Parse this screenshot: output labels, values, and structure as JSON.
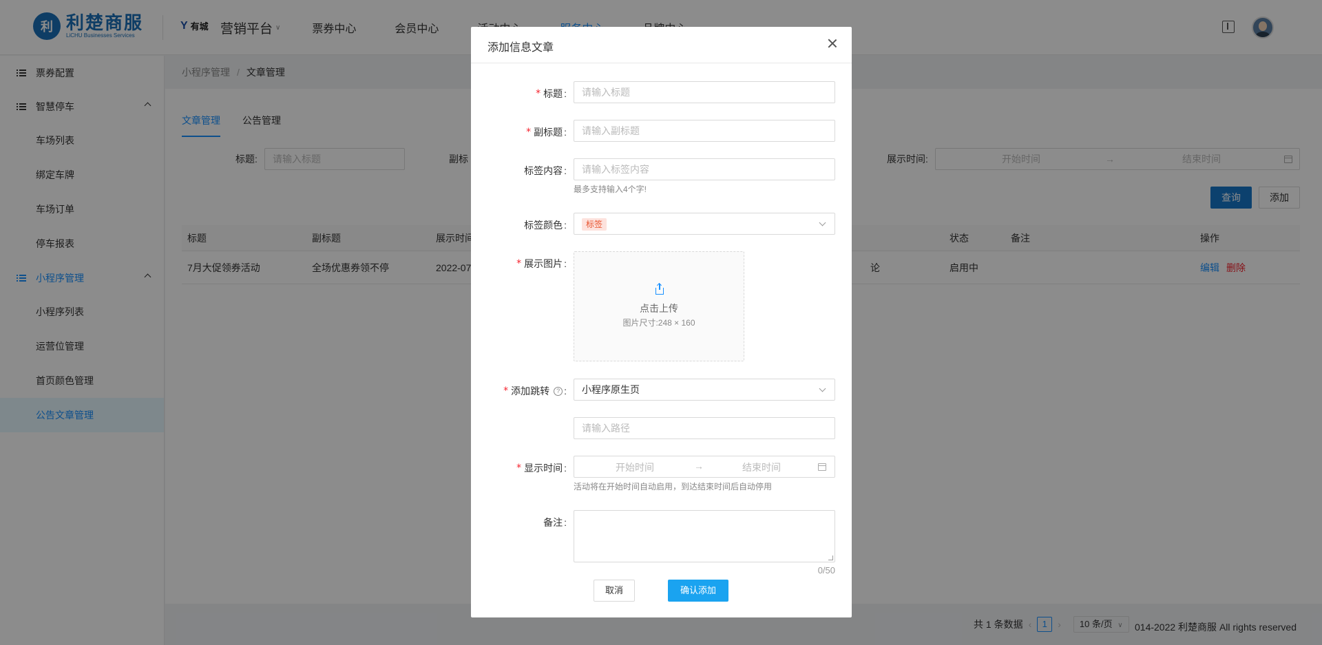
{
  "header": {
    "logo_main": "利楚商服",
    "logo_sub": "LiCHU Businesses Services",
    "brand": "有城",
    "nav": [
      {
        "label": "营销平台"
      },
      {
        "label": "票券中心"
      },
      {
        "label": "会员中心"
      },
      {
        "label": "活动中心"
      },
      {
        "label": "服务中心"
      },
      {
        "label": "品牌中心"
      }
    ]
  },
  "sidebar": {
    "items": [
      {
        "label": "票券配置"
      },
      {
        "label": "智慧停车"
      },
      {
        "label": "车场列表"
      },
      {
        "label": "绑定车牌"
      },
      {
        "label": "车场订单"
      },
      {
        "label": "停车报表"
      },
      {
        "label": "小程序管理"
      },
      {
        "label": "小程序列表"
      },
      {
        "label": "运营位管理"
      },
      {
        "label": "首页颜色管理"
      },
      {
        "label": "公告文章管理"
      }
    ]
  },
  "breadcrumb": {
    "parent": "小程序管理",
    "sep": "/",
    "current": "文章管理"
  },
  "tabs": [
    {
      "label": "文章管理"
    },
    {
      "label": "公告管理"
    }
  ],
  "filters": {
    "title_label": "标题:",
    "title_placeholder": "请输入标题",
    "subtitle_label": "副标",
    "time_label": "展示时间:",
    "start_placeholder": "开始时间",
    "end_placeholder": "结束时间",
    "query": "查询",
    "add": "添加"
  },
  "table": {
    "headers": {
      "title": "标题",
      "subtitle": "副标题",
      "time": "展示时间",
      "status": "状态",
      "remark": "备注",
      "ops": "操作"
    },
    "rows": [
      {
        "title": "7月大促领券活动",
        "subtitle": "全场优惠券领不停",
        "time": "2022-07",
        "tag": "论",
        "status": "启用中",
        "edit": "编辑",
        "delete": "删除"
      }
    ]
  },
  "pager": {
    "total": "共 1 条数据",
    "page": "1",
    "size": "10 条/页"
  },
  "copyright": "014-2022 利楚商服 All rights reserved",
  "modal": {
    "title": "添加信息文章",
    "fields": {
      "title_label": "标题",
      "title_placeholder": "请输入标题",
      "subtitle_label": "副标题",
      "subtitle_placeholder": "请输入副标题",
      "tag_label": "标签内容",
      "tag_placeholder": "请输入标签内容",
      "tag_help": "最多支持输入4个字!",
      "color_label": "标签颜色",
      "color_value": "标签",
      "image_label": "展示图片",
      "upload_text": "点击上传",
      "upload_hint": "图片尺寸:248 × 160",
      "jump_label": "添加跳转",
      "jump_value": "小程序原生页",
      "path_placeholder": "请输入路径",
      "time_label": "显示时间",
      "start_placeholder": "开始时间",
      "end_placeholder": "结束时间",
      "time_help": "活动将在开始时间自动启用，到达结束时间后自动停用",
      "remark_label": "备注",
      "remark_counter": "0/50"
    },
    "cancel": "取消",
    "confirm": "确认添加"
  }
}
